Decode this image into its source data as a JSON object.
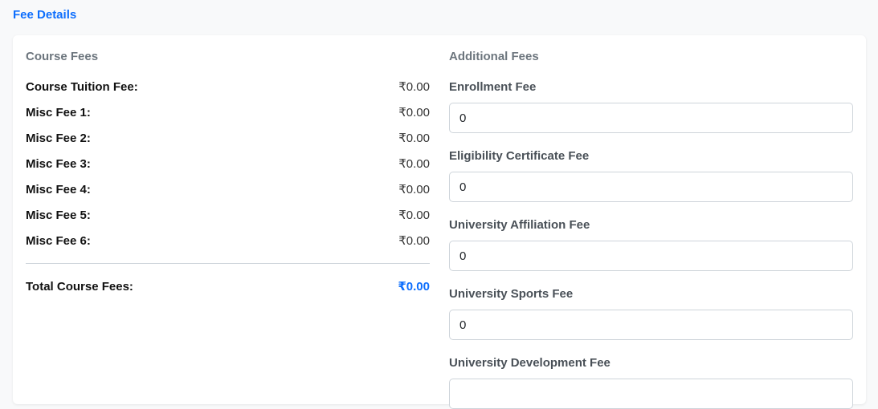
{
  "header": {
    "link_label": "Fee Details"
  },
  "course_fees": {
    "title": "Course Fees",
    "rows": [
      {
        "label": "Course Tuition Fee:",
        "value": "₹0.00"
      },
      {
        "label": "Misc Fee 1:",
        "value": "₹0.00"
      },
      {
        "label": "Misc Fee 2:",
        "value": "₹0.00"
      },
      {
        "label": "Misc Fee 3:",
        "value": "₹0.00"
      },
      {
        "label": "Misc Fee 4:",
        "value": "₹0.00"
      },
      {
        "label": "Misc Fee 5:",
        "value": "₹0.00"
      },
      {
        "label": "Misc Fee 6:",
        "value": "₹0.00"
      }
    ],
    "total": {
      "label": "Total Course Fees:",
      "value": "₹0.00"
    }
  },
  "additional_fees": {
    "title": "Additional Fees",
    "fields": [
      {
        "label": "Enrollment Fee",
        "value": "0"
      },
      {
        "label": "Eligibility Certificate Fee",
        "value": "0"
      },
      {
        "label": "University Affiliation Fee",
        "value": "0"
      },
      {
        "label": "University Sports Fee",
        "value": "0"
      },
      {
        "label": "University Development Fee",
        "value": ""
      }
    ]
  },
  "colors": {
    "accent": "#0d6efd",
    "muted": "#6c757d",
    "border": "#ced4da"
  }
}
